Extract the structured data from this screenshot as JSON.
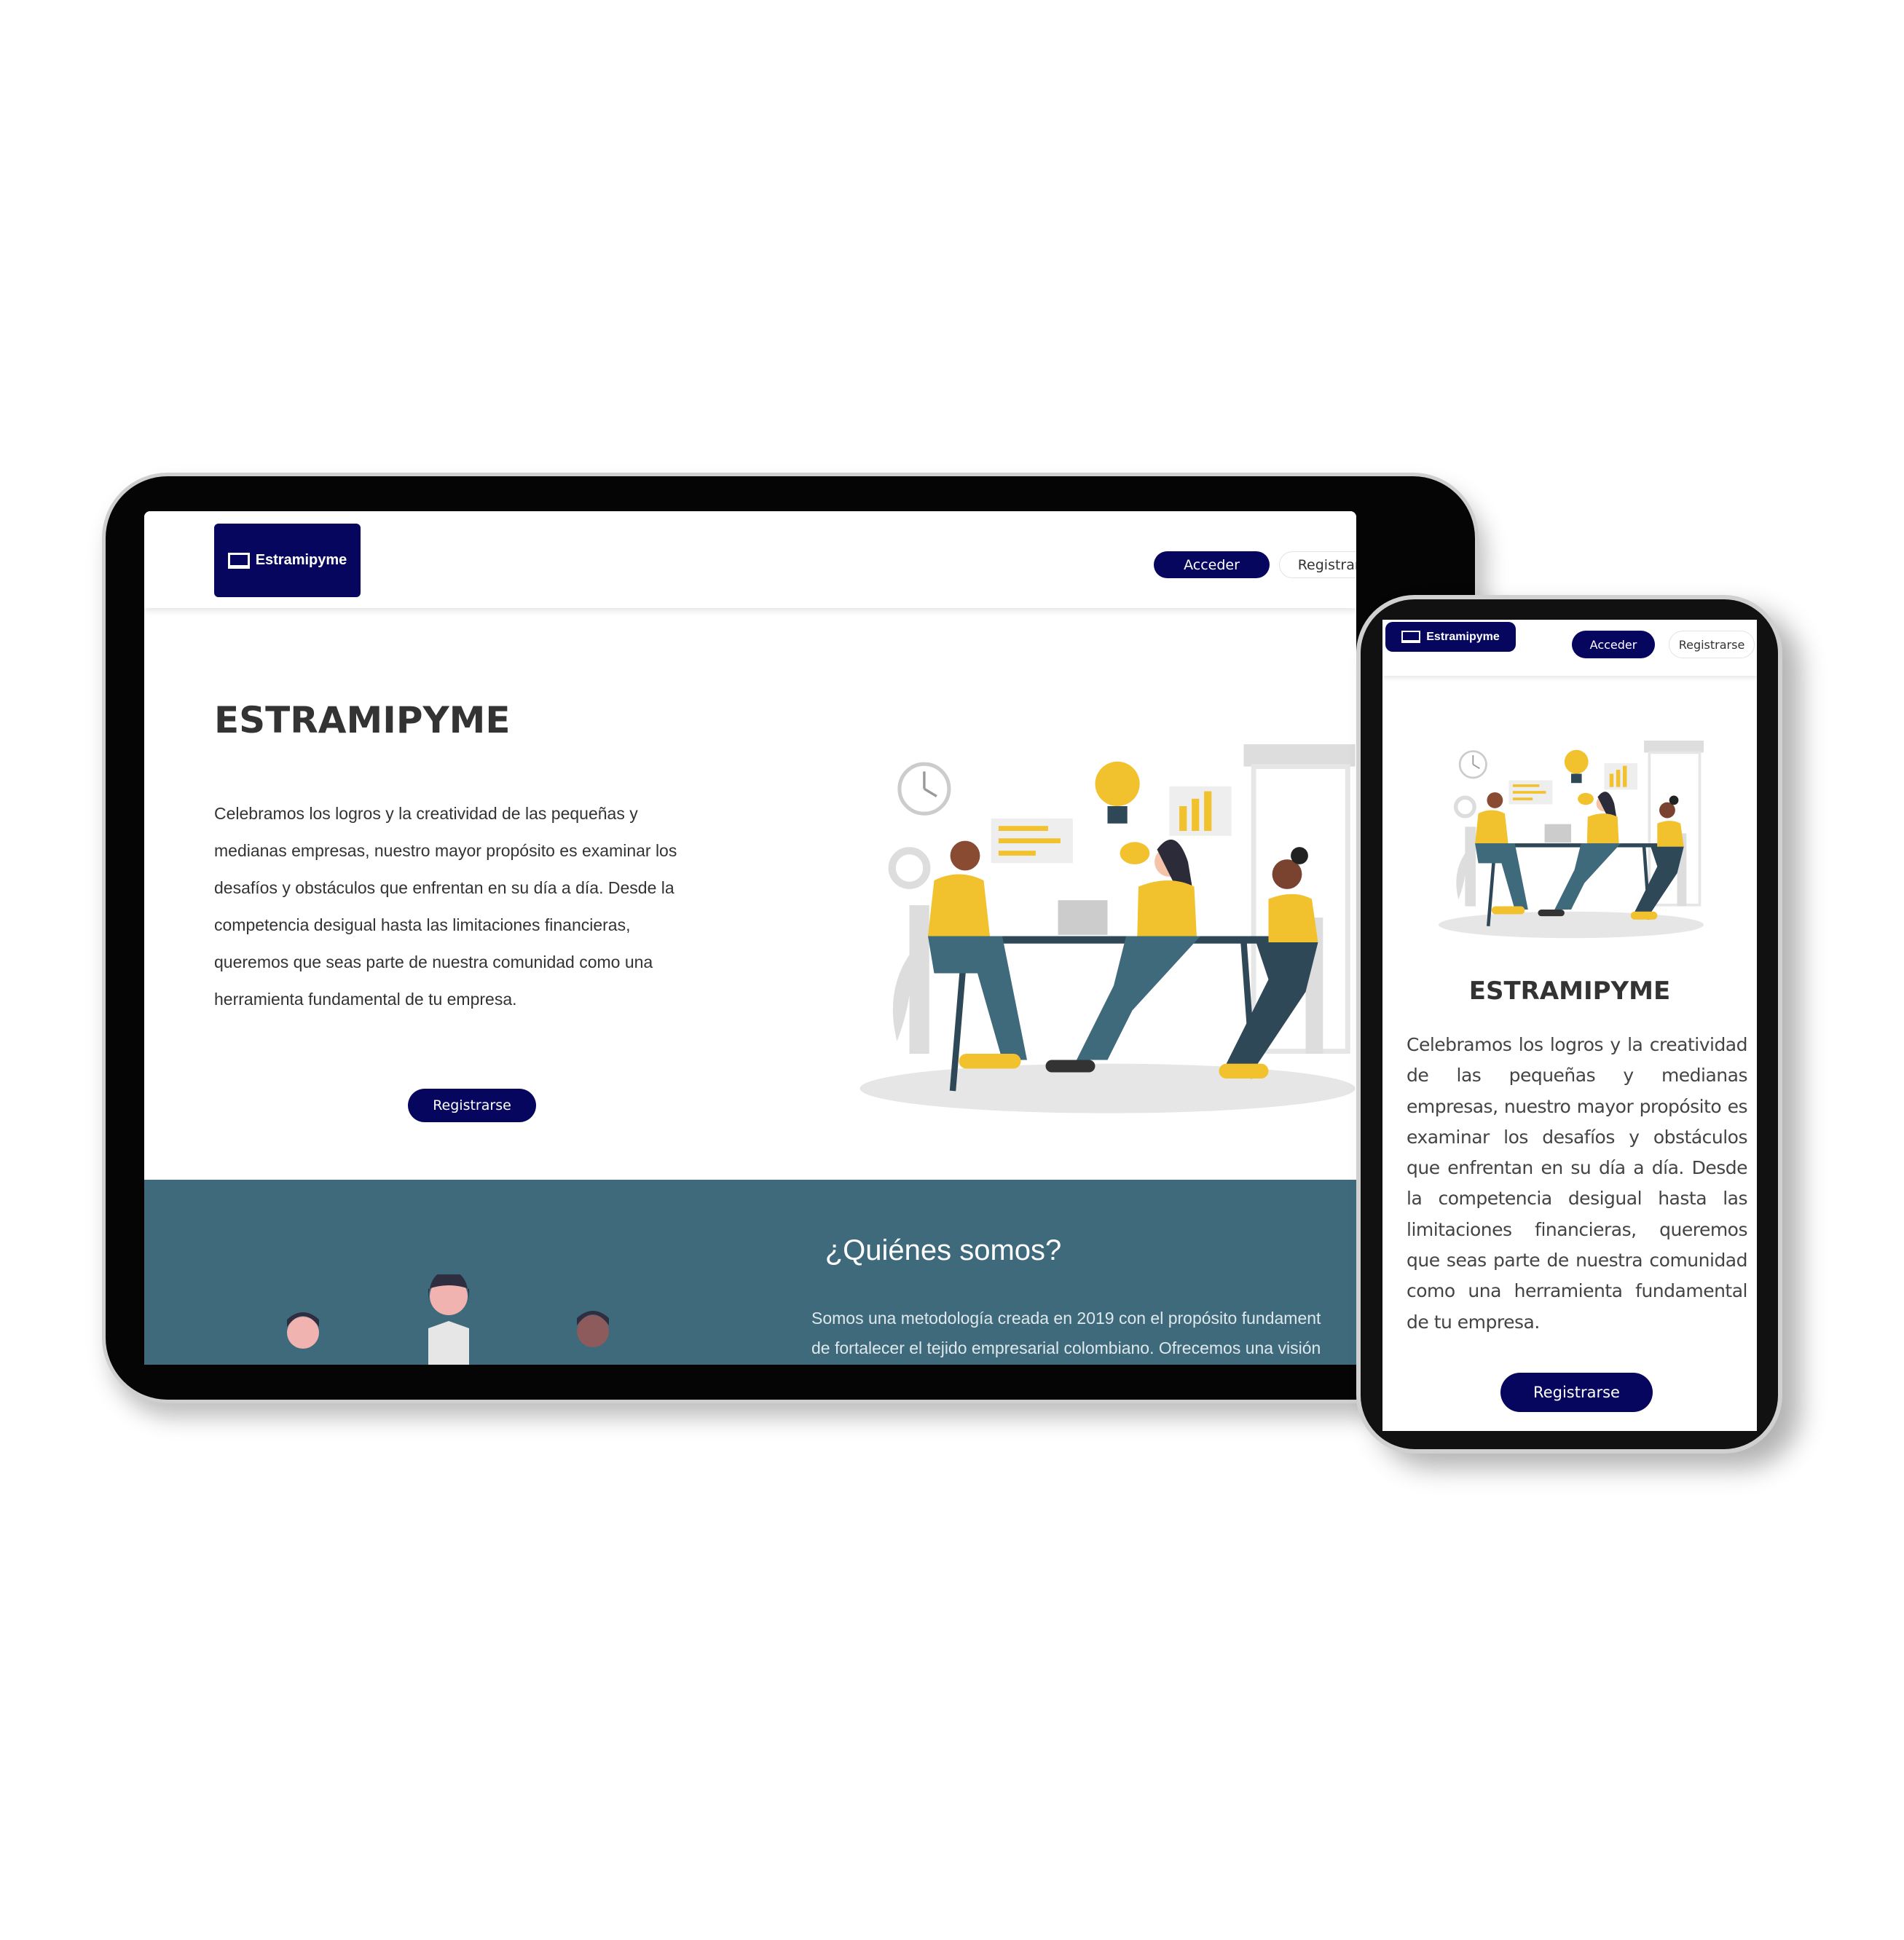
{
  "brand": {
    "name": "Estramipyme",
    "logo_icon": "laptop-chart-icon",
    "color": "#06065f"
  },
  "nav": {
    "login": "Acceder",
    "register": "Registrarse"
  },
  "hero": {
    "title": "ESTRAMIPYME",
    "text": "Celebramos los logros y la creatividad de las pequeñas y medianas empresas, nuestro mayor propósito es examinar los desafíos y obstáculos que enfrentan en su día a día. Desde la competencia desigual hasta las limitaciones financieras, queremos que seas parte de nuestra comunidad como una herramienta fundamental de tu empresa.",
    "text_lines": [
      "Celebramos los logros y la creatividad de las pequeñas y",
      "medianas empresas, nuestro mayor propósito es examinar los",
      "desafíos y obstáculos que enfrentan en su día a día. Desde la",
      "competencia desigual hasta las limitaciones financieras,",
      "queremos que seas parte de nuestra comunidad como una",
      "herramienta fundamental de tu empresa."
    ],
    "cta": "Registrarse",
    "illustration": "team-meeting-illustration"
  },
  "about": {
    "title": "¿Quiénes somos?",
    "lines": [
      "Somos una metodología creada en 2019 con el propósito fundament",
      "de fortalecer el tejido empresarial colombiano. Ofrecemos una visión"
    ],
    "background": "#3e6a7c"
  }
}
